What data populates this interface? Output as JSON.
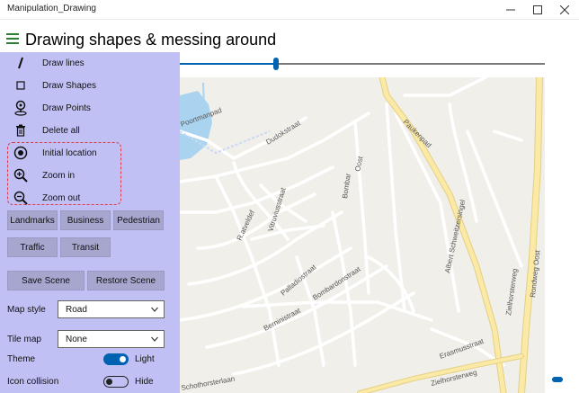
{
  "window": {
    "title": "Manipulation_Drawing"
  },
  "header": {
    "title": "Drawing shapes & messing around"
  },
  "slider": {
    "value_fraction": 0.26
  },
  "menu": {
    "items": [
      {
        "label": "Draw lines",
        "icon": "draw-line-icon"
      },
      {
        "label": "Draw Shapes",
        "icon": "square-icon"
      },
      {
        "label": "Draw Points",
        "icon": "map-pin-icon"
      },
      {
        "label": "Delete all",
        "icon": "trash-icon"
      },
      {
        "label": "Initial location",
        "icon": "target-icon"
      },
      {
        "label": "Zoom in",
        "icon": "zoom-in-icon"
      },
      {
        "label": "Zoom out",
        "icon": "zoom-out-icon"
      }
    ]
  },
  "buttons": {
    "landmarks": "Landmarks",
    "business": "Business",
    "pedestrian": "Pedestrian",
    "traffic": "Traffic",
    "transit": "Transit",
    "save_scene": "Save Scene",
    "restore_scene": "Restore Scene"
  },
  "settings": {
    "map_style": {
      "label": "Map style",
      "value": "Road"
    },
    "tile_map": {
      "label": "Tile map",
      "value": "None"
    },
    "theme": {
      "label": "Theme",
      "state": "on",
      "text": "Light"
    },
    "icon_collision": {
      "label": "Icon collision",
      "state": "off",
      "text": "Hide"
    }
  },
  "map": {
    "street_labels": [
      "Dudokstraat",
      "Oost",
      "Bombar",
      "Paukenpad",
      "Poortmanpad",
      "Albert Schweitzersingel",
      "Vitruviusstraat",
      "R.atveldef",
      "Palladiostraat",
      "Bombardonstraat",
      "Berninistraat",
      "Zielhorsterweg",
      "Rondweg Oost",
      "Erasmusstraat",
      "Zielhorsterweg",
      "Schothorsterlaan"
    ]
  },
  "colors": {
    "panel_bg": "#c0c0f4",
    "accent": "#0063b1",
    "button_bg": "#a6a6ce",
    "map_bg": "#f1efe9",
    "water": "#aad3f0",
    "major_road": "#fbe9a6",
    "hamburger": "#2e7d32",
    "group_border": "#e0394c"
  }
}
